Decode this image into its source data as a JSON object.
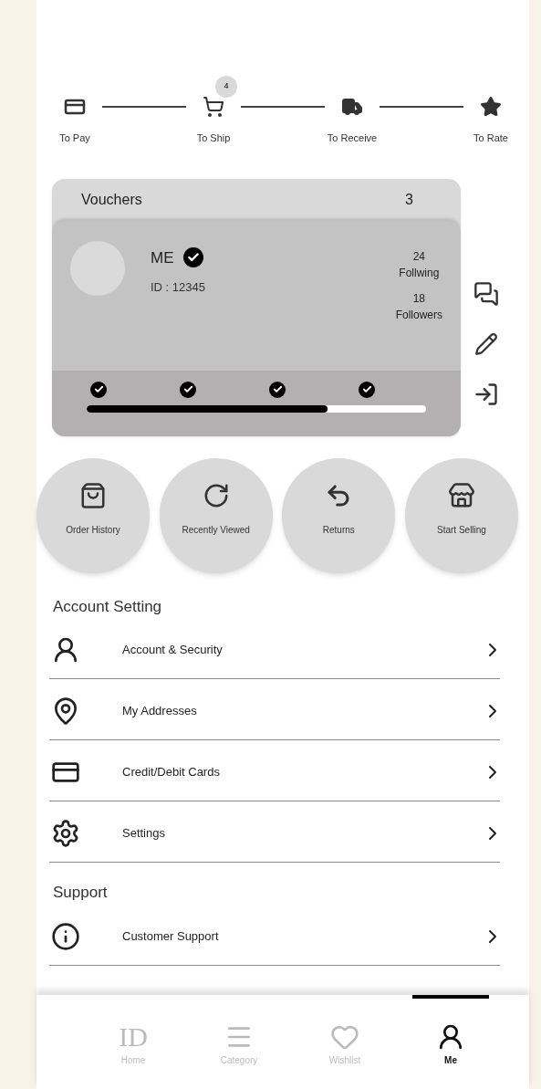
{
  "order_steps": [
    {
      "kind": "card",
      "label": "To Pay"
    },
    {
      "kind": "cart",
      "label": "To Ship",
      "badge": "4"
    },
    {
      "kind": "truck",
      "label": "To Receive"
    },
    {
      "kind": "star",
      "label": "To Rate"
    }
  ],
  "vouchers": {
    "label": "Vouchers",
    "count": "3"
  },
  "profile": {
    "name": "ME",
    "verified": true,
    "id": "ID : 12345",
    "following_count": "24",
    "following_label": "Follwing",
    "followers_count": "18",
    "followers_label": "Followers"
  },
  "milestones": [
    {
      "checked": true
    },
    {
      "checked": true
    },
    {
      "checked": true
    },
    {
      "checked": true
    }
  ],
  "progress": {
    "level": 0.71
  },
  "quick_actions": [
    {
      "kind": "bag",
      "label": "Order History"
    },
    {
      "kind": "refresh",
      "label": "Recently Viewed"
    },
    {
      "kind": "return",
      "label": "Returns"
    },
    {
      "kind": "store",
      "label": "Start Selling"
    }
  ],
  "sections": [
    {
      "title": "Account Setting",
      "items": [
        {
          "kind": "user-key",
          "label": "Account & Security"
        },
        {
          "kind": "pin",
          "label": "My Addresses"
        },
        {
          "kind": "card",
          "label": "Credit/Debit Cards"
        },
        {
          "kind": "gear",
          "label": "Settings"
        }
      ]
    },
    {
      "title": "Support",
      "items": [
        {
          "kind": "info",
          "label": "Customer Support"
        }
      ]
    }
  ],
  "bottom_nav": [
    {
      "kind": "logo",
      "logo": "ID",
      "label": "Home",
      "selected": false
    },
    {
      "kind": "menu",
      "label": "Category",
      "selected": false
    },
    {
      "kind": "heart",
      "label": "Wishlist",
      "selected": false
    },
    {
      "kind": "user",
      "label": "Me",
      "selected": true
    }
  ]
}
